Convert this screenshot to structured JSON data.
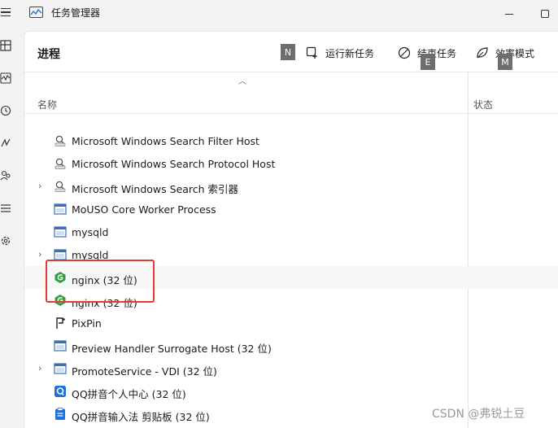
{
  "window": {
    "title": "任务管理器"
  },
  "page": {
    "title": "进程"
  },
  "toolbar": {
    "run_new_task": "运行新任务",
    "end_task": "结束任务",
    "efficiency_mode": "效率模式",
    "key_n": "N",
    "key_e": "E",
    "key_m": "M"
  },
  "columns": {
    "name": "名称",
    "status": "状态"
  },
  "processes": [
    {
      "name": "Microsoft Windows Search Filter Host",
      "icon": "search-service-icon",
      "expandable": false
    },
    {
      "name": "Microsoft Windows Search Protocol Host",
      "icon": "search-service-icon",
      "expandable": false
    },
    {
      "name": "Microsoft Windows Search 索引器",
      "icon": "search-service-icon",
      "expandable": true
    },
    {
      "name": "MoUSO Core Worker Process",
      "icon": "window-app-icon",
      "expandable": false
    },
    {
      "name": "mysqld",
      "icon": "window-app-icon",
      "expandable": false
    },
    {
      "name": "mysqld",
      "icon": "window-app-icon",
      "expandable": true
    },
    {
      "name": "nginx (32 位)",
      "icon": "nginx-icon",
      "expandable": false
    },
    {
      "name": "nginx (32 位)",
      "icon": "nginx-icon",
      "expandable": false
    },
    {
      "name": "PixPin",
      "icon": "pixpin-icon",
      "expandable": false
    },
    {
      "name": "Preview Handler Surrogate Host (32 位)",
      "icon": "window-app-icon",
      "expandable": false
    },
    {
      "name": "PromoteService - VDI (32 位)",
      "icon": "window-app-icon",
      "expandable": true
    },
    {
      "name": "QQ拼音个人中心 (32 位)",
      "icon": "qq-pinyin-icon",
      "expandable": false
    },
    {
      "name": "QQ拼音输入法 剪贴板 (32 位)",
      "icon": "qq-clipboard-icon",
      "expandable": false
    }
  ],
  "watermark": "CSDN @弗锐土豆",
  "colors": {
    "highlight_box": "#e53935",
    "nginx_green": "#2e9e3e",
    "qq_blue": "#1e6fe0"
  }
}
